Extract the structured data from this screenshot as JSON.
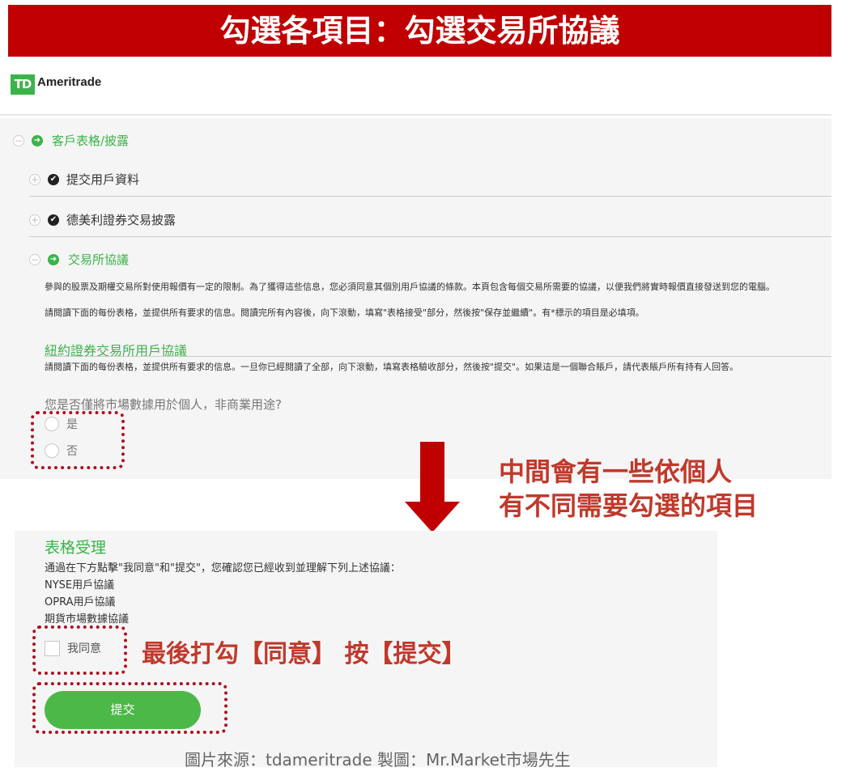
{
  "banner": {
    "title": "勾選各項目：勾選交易所協議"
  },
  "logo": {
    "mark": "TD",
    "name": "Ameritrade"
  },
  "sections": {
    "client_forms": "客戶表格/披露",
    "submit_user_data": "提交用戶資料",
    "td_disclosure": "德美利證券交易披露",
    "exchange_agreements": "交易所協議"
  },
  "exchange": {
    "para1": "參與的股票及期權交易所對使用報價有一定的限制。為了獲得這些信息，您必須同意其個別用戶協議的條款。本頁包含每個交易所需要的協議，以便我們將實時報價直接發送到您的電腦。",
    "para2": "請閱讀下面的每份表格，並提供所有要求的信息。閱讀完所有內容後，向下滾動，填寫\"表格接受\"部分，然後按\"保存並繼續\"。有*標示的項目是必填項。",
    "nyse_heading": "紐約證券交易所用戶協議",
    "nyse_note": "請閱讀下面的每份表格，並提供所有要求的信息。一旦你已經閱讀了全部，向下滾動，填寫表格驗收部分，然後按\"提交\"。如果這是一個聯合賬戶，請代表賬戶所有持有人回答。",
    "question": "您是否僅將市場數據用於個人，非商業用途?",
    "option_yes": "是",
    "option_no": "否"
  },
  "annotation": {
    "line1": "中間會有一些依個人",
    "line2": "有不同需要勾選的項目",
    "final": "最後打勾【同意】 按【提交】"
  },
  "acceptance": {
    "title": "表格受理",
    "intro": "通過在下方點擊\"我同意\"和\"提交\"，您確認您已經收到並理解下列上述協議：",
    "items": [
      "NYSE用戶協議",
      "OPRA用戶協議",
      "期貨市場數據協議"
    ],
    "agree_label": "我同意",
    "submit_label": "提交"
  },
  "credit": "圖片來源：tdameritrade  製圖：Mr.Market市場先生",
  "colors": {
    "brand_red": "#c00000",
    "td_green": "#3cb34a",
    "annotation_red": "#c0392b"
  }
}
